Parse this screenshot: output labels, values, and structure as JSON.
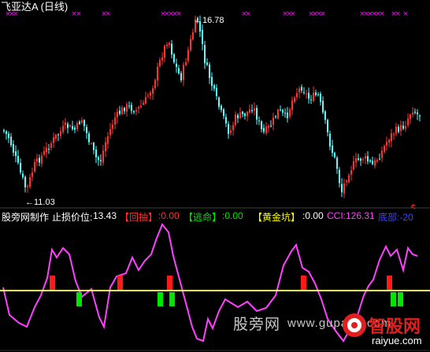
{
  "window": {
    "title": "飞亚达A (日线)",
    "high_label": "16.78",
    "low_label": "11.03"
  },
  "indicator": {
    "name": "股旁网制作",
    "stop_loss_label": "止损价位:",
    "stop_loss_value": "13.43",
    "items": [
      {
        "bracket": "【回抽】",
        "value": ":0.00",
        "color": "#ff3030"
      },
      {
        "bracket": "【逃命】",
        "value": ":0.00",
        "color": "#00e600"
      },
      {
        "bracket": "【黄金坑】",
        "value": ":0.00",
        "color": "#ffff00"
      }
    ],
    "cci_label": "CCI:126.31",
    "bottom_label": "底部:-20"
  },
  "watermark": {
    "site_cn": "股旁网",
    "site_url": "www.gupang.com",
    "logo_cn": "智股网",
    "logo_url": "raiyue.com"
  },
  "colors": {
    "background": "#000000",
    "up_candle": "#ff3232",
    "down_candle": "#54ffff",
    "marker": "#ff00ff",
    "cci_line": "#ff40ff",
    "baseline": "#ffff66",
    "buy_bar": "#ff1a1a",
    "sell_bar": "#00e600"
  },
  "icons": [
    "x-signal-marker-icon",
    "dollar-signal-icon",
    "arrow-left-icon"
  ]
}
